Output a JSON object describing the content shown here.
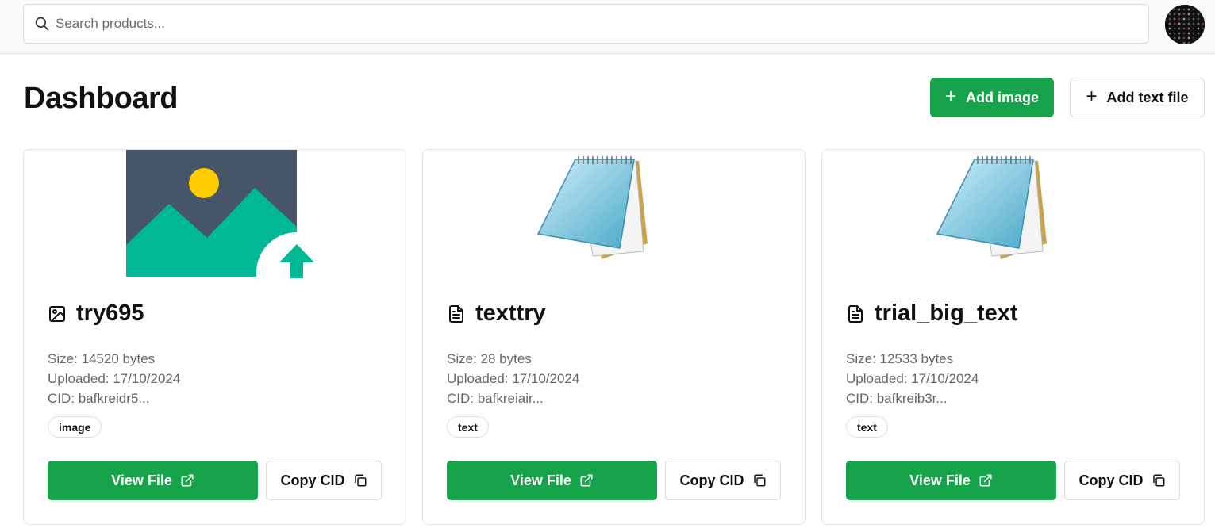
{
  "header": {
    "search_placeholder": "Search products...",
    "search_value": ""
  },
  "page": {
    "title": "Dashboard",
    "add_image_label": "Add image",
    "add_text_label": "Add text file"
  },
  "colors": {
    "accent": "#16a34a",
    "image_bg": "#475569",
    "image_mountain": "#00b894",
    "image_sun": "#ffcc00"
  },
  "cards": [
    {
      "name": "try695",
      "icon": "image-icon",
      "size": "Size: 14520 bytes",
      "uploaded": "Uploaded: 17/10/2024",
      "cid": "CID: bafkreidr5...",
      "tag": "image",
      "view_label": "View File",
      "copy_label": "Copy CID"
    },
    {
      "name": "texttry",
      "icon": "file-text-icon",
      "size": "Size: 28 bytes",
      "uploaded": "Uploaded: 17/10/2024",
      "cid": "CID: bafkreiair...",
      "tag": "text",
      "view_label": "View File",
      "copy_label": "Copy CID"
    },
    {
      "name": "trial_big_text",
      "icon": "file-text-icon",
      "size": "Size: 12533 bytes",
      "uploaded": "Uploaded: 17/10/2024",
      "cid": "CID: bafkreib3r...",
      "tag": "text",
      "view_label": "View File",
      "copy_label": "Copy CID"
    }
  ]
}
